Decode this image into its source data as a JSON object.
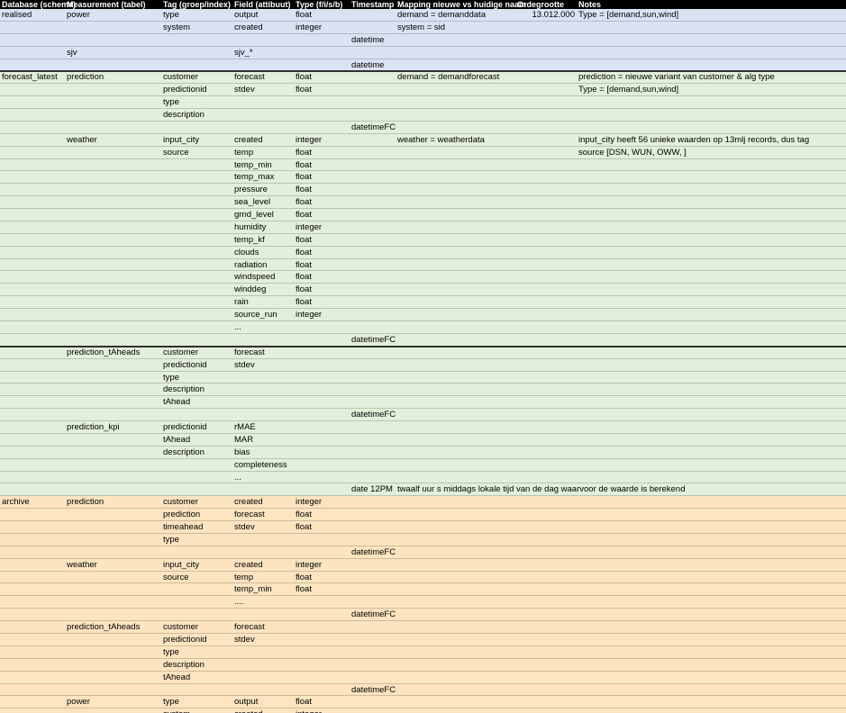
{
  "header": {
    "db": "Database (schema)",
    "measurement": "Measurement (tabel)",
    "tag": "Tag (groep/index)",
    "field": "Field (attibuut)",
    "type": "Type (f/i/s/b)",
    "timestamp": "Timestamp",
    "mapping": "Mapping nieuwe vs huidige naam",
    "ordegrootte": "Ordegrootte",
    "notes": "Notes"
  },
  "rows": [
    {
      "section": "blue",
      "db": "realised",
      "measurement": "power",
      "tag": "type",
      "field": "output",
      "type": "float",
      "timestamp": "",
      "mapping": "demand = demanddata",
      "ordegrootte": "13.012.000",
      "notes": "Type = [demand,sun,wind]"
    },
    {
      "section": "blue",
      "db": "",
      "measurement": "",
      "tag": "system",
      "field": "created",
      "type": "integer",
      "timestamp": "",
      "mapping": "system = sid",
      "ordegrootte": "",
      "notes": ""
    },
    {
      "section": "blue",
      "db": "",
      "measurement": "",
      "tag": "",
      "field": "",
      "type": "",
      "timestamp": "datetime",
      "mapping": "",
      "ordegrootte": "",
      "notes": ""
    },
    {
      "section": "blue",
      "db": "",
      "measurement": "sjv",
      "tag": "",
      "field": "sjv_*",
      "type": "",
      "timestamp": "",
      "mapping": "",
      "ordegrootte": "",
      "notes": ""
    },
    {
      "section": "blue",
      "db": "",
      "measurement": "",
      "tag": "",
      "field": "",
      "type": "",
      "timestamp": "datetime",
      "mapping": "",
      "ordegrootte": "",
      "notes": ""
    },
    {
      "section": "green",
      "db": "forecast_latest",
      "measurement": "prediction",
      "tag": "customer",
      "field": "forecast",
      "type": "float",
      "timestamp": "",
      "mapping": "demand = demandforecast",
      "ordegrootte": "",
      "notes": "prediction = nieuwe variant van customer & alg type"
    },
    {
      "section": "green",
      "db": "",
      "measurement": "",
      "tag": "predictionid",
      "field": "stdev",
      "type": "float",
      "timestamp": "",
      "mapping": "",
      "ordegrootte": "",
      "notes": "Type = [demand,sun,wind]"
    },
    {
      "section": "green",
      "db": "",
      "measurement": "",
      "tag": "type",
      "field": "",
      "type": "",
      "timestamp": "",
      "mapping": "",
      "ordegrootte": "",
      "notes": ""
    },
    {
      "section": "green",
      "db": "",
      "measurement": "",
      "tag": "description",
      "field": "",
      "type": "",
      "timestamp": "",
      "mapping": "",
      "ordegrootte": "",
      "notes": ""
    },
    {
      "section": "green",
      "db": "",
      "measurement": "",
      "tag": "",
      "field": "",
      "type": "",
      "timestamp": "datetimeFC",
      "mapping": "",
      "ordegrootte": "",
      "notes": ""
    },
    {
      "section": "green",
      "db": "",
      "measurement": "weather",
      "tag": "input_city",
      "field": "created",
      "type": "integer",
      "timestamp": "",
      "mapping": "weather = weatherdata",
      "ordegrootte": "",
      "notes": "input_city heeft 56 unieke waarden op 13mlj records, dus tag"
    },
    {
      "section": "green",
      "db": "",
      "measurement": "",
      "tag": "source",
      "field": "temp",
      "type": "float",
      "timestamp": "",
      "mapping": "",
      "ordegrootte": "",
      "notes": "source [DSN, WUN, OWW, ]"
    },
    {
      "section": "green",
      "db": "",
      "measurement": "",
      "tag": "",
      "field": "temp_min",
      "type": "float",
      "timestamp": "",
      "mapping": "",
      "ordegrootte": "",
      "notes": ""
    },
    {
      "section": "green",
      "db": "",
      "measurement": "",
      "tag": "",
      "field": "temp_max",
      "type": "float",
      "timestamp": "",
      "mapping": "",
      "ordegrootte": "",
      "notes": ""
    },
    {
      "section": "green",
      "db": "",
      "measurement": "",
      "tag": "",
      "field": "pressure",
      "type": "float",
      "timestamp": "",
      "mapping": "",
      "ordegrootte": "",
      "notes": ""
    },
    {
      "section": "green",
      "db": "",
      "measurement": "",
      "tag": "",
      "field": "sea_level",
      "type": "float",
      "timestamp": "",
      "mapping": "",
      "ordegrootte": "",
      "notes": ""
    },
    {
      "section": "green",
      "db": "",
      "measurement": "",
      "tag": "",
      "field": "grnd_level",
      "type": "float",
      "timestamp": "",
      "mapping": "",
      "ordegrootte": "",
      "notes": ""
    },
    {
      "section": "green",
      "db": "",
      "measurement": "",
      "tag": "",
      "field": "humidity",
      "type": "integer",
      "timestamp": "",
      "mapping": "",
      "ordegrootte": "",
      "notes": ""
    },
    {
      "section": "green",
      "db": "",
      "measurement": "",
      "tag": "",
      "field": "temp_kf",
      "type": "float",
      "timestamp": "",
      "mapping": "",
      "ordegrootte": "",
      "notes": ""
    },
    {
      "section": "green",
      "db": "",
      "measurement": "",
      "tag": "",
      "field": "clouds",
      "type": "float",
      "timestamp": "",
      "mapping": "",
      "ordegrootte": "",
      "notes": ""
    },
    {
      "section": "green",
      "db": "",
      "measurement": "",
      "tag": "",
      "field": "radiation",
      "type": "float",
      "timestamp": "",
      "mapping": "",
      "ordegrootte": "",
      "notes": ""
    },
    {
      "section": "green",
      "db": "",
      "measurement": "",
      "tag": "",
      "field": "windspeed",
      "type": "float",
      "timestamp": "",
      "mapping": "",
      "ordegrootte": "",
      "notes": ""
    },
    {
      "section": "green",
      "db": "",
      "measurement": "",
      "tag": "",
      "field": "winddeg",
      "type": "float",
      "timestamp": "",
      "mapping": "",
      "ordegrootte": "",
      "notes": ""
    },
    {
      "section": "green",
      "db": "",
      "measurement": "",
      "tag": "",
      "field": "rain",
      "type": "float",
      "timestamp": "",
      "mapping": "",
      "ordegrootte": "",
      "notes": ""
    },
    {
      "section": "green",
      "db": "",
      "measurement": "",
      "tag": "",
      "field": "source_run",
      "type": "integer",
      "timestamp": "",
      "mapping": "",
      "ordegrootte": "",
      "notes": ""
    },
    {
      "section": "green",
      "db": "",
      "measurement": "",
      "tag": "",
      "field": "...",
      "type": "",
      "timestamp": "",
      "mapping": "",
      "ordegrootte": "",
      "notes": ""
    },
    {
      "section": "green",
      "db": "",
      "measurement": "",
      "tag": "",
      "field": "",
      "type": "",
      "timestamp": "datetimeFC",
      "mapping": "",
      "ordegrootte": "",
      "notes": ""
    },
    {
      "section": "green",
      "db": "",
      "measurement": "prediction_tAheads",
      "tag": "customer",
      "field": "forecast",
      "type": "",
      "timestamp": "",
      "mapping": "",
      "ordegrootte": "",
      "notes": ""
    },
    {
      "section": "green",
      "db": "",
      "measurement": "",
      "tag": "predictionid",
      "field": "stdev",
      "type": "",
      "timestamp": "",
      "mapping": "",
      "ordegrootte": "",
      "notes": ""
    },
    {
      "section": "green",
      "db": "",
      "measurement": "",
      "tag": "type",
      "field": "",
      "type": "",
      "timestamp": "",
      "mapping": "",
      "ordegrootte": "",
      "notes": ""
    },
    {
      "section": "green",
      "db": "",
      "measurement": "",
      "tag": "description",
      "field": "",
      "type": "",
      "timestamp": "",
      "mapping": "",
      "ordegrootte": "",
      "notes": ""
    },
    {
      "section": "green",
      "db": "",
      "measurement": "",
      "tag": "tAhead",
      "field": "",
      "type": "",
      "timestamp": "",
      "mapping": "",
      "ordegrootte": "",
      "notes": ""
    },
    {
      "section": "green",
      "db": "",
      "measurement": "",
      "tag": "",
      "field": "",
      "type": "",
      "timestamp": "datetimeFC",
      "mapping": "",
      "ordegrootte": "",
      "notes": ""
    },
    {
      "section": "green",
      "db": "",
      "measurement": "prediction_kpi",
      "tag": "predictionid",
      "field": "rMAE",
      "type": "",
      "timestamp": "",
      "mapping": "",
      "ordegrootte": "",
      "notes": ""
    },
    {
      "section": "green",
      "db": "",
      "measurement": "",
      "tag": "tAhead",
      "field": "MAR",
      "type": "",
      "timestamp": "",
      "mapping": "",
      "ordegrootte": "",
      "notes": ""
    },
    {
      "section": "green",
      "db": "",
      "measurement": "",
      "tag": "description",
      "field": "bias",
      "type": "",
      "timestamp": "",
      "mapping": "",
      "ordegrootte": "",
      "notes": ""
    },
    {
      "section": "green",
      "db": "",
      "measurement": "",
      "tag": "",
      "field": "completeness",
      "type": "",
      "timestamp": "",
      "mapping": "",
      "ordegrootte": "",
      "notes": ""
    },
    {
      "section": "green",
      "db": "",
      "measurement": "",
      "tag": "",
      "field": "...",
      "type": "",
      "timestamp": "",
      "mapping": "",
      "ordegrootte": "",
      "notes": ""
    },
    {
      "section": "green",
      "db": "",
      "measurement": "",
      "tag": "",
      "field": "",
      "type": "",
      "timestamp": "date 12PM",
      "mapping": "twaalf uur s middags lokale tijd van de dag waarvoor de waarde is berekend",
      "ordegrootte": "",
      "notes": ""
    },
    {
      "section": "orange",
      "db": "archive",
      "measurement": "prediction",
      "tag": "customer",
      "field": "created",
      "type": "integer",
      "timestamp": "",
      "mapping": "",
      "ordegrootte": "",
      "notes": ""
    },
    {
      "section": "orange",
      "db": "",
      "measurement": "",
      "tag": "prediction",
      "field": "forecast",
      "type": "float",
      "timestamp": "",
      "mapping": "",
      "ordegrootte": "",
      "notes": ""
    },
    {
      "section": "orange",
      "db": "",
      "measurement": "",
      "tag": "timeahead",
      "field": "stdev",
      "type": "float",
      "timestamp": "",
      "mapping": "",
      "ordegrootte": "",
      "notes": ""
    },
    {
      "section": "orange",
      "db": "",
      "measurement": "",
      "tag": "type",
      "field": "",
      "type": "",
      "timestamp": "",
      "mapping": "",
      "ordegrootte": "",
      "notes": ""
    },
    {
      "section": "orange",
      "db": "",
      "measurement": "",
      "tag": "",
      "field": "",
      "type": "",
      "timestamp": "datetimeFC",
      "mapping": "",
      "ordegrootte": "",
      "notes": ""
    },
    {
      "section": "orange",
      "db": "",
      "measurement": "weather",
      "tag": "input_city",
      "field": "created",
      "type": "integer",
      "timestamp": "",
      "mapping": "",
      "ordegrootte": "",
      "notes": ""
    },
    {
      "section": "orange",
      "db": "",
      "measurement": "",
      "tag": "source",
      "field": "temp",
      "type": "float",
      "timestamp": "",
      "mapping": "",
      "ordegrootte": "",
      "notes": ""
    },
    {
      "section": "orange",
      "db": "",
      "measurement": "",
      "tag": "",
      "field": "temp_min",
      "type": "float",
      "timestamp": "",
      "mapping": "",
      "ordegrootte": "",
      "notes": ""
    },
    {
      "section": "orange",
      "db": "",
      "measurement": "",
      "tag": "",
      "field": "....",
      "type": "",
      "timestamp": "",
      "mapping": "",
      "ordegrootte": "",
      "notes": ""
    },
    {
      "section": "orange",
      "db": "",
      "measurement": "",
      "tag": "",
      "field": "",
      "type": "",
      "timestamp": "datetimeFC",
      "mapping": "",
      "ordegrootte": "",
      "notes": ""
    },
    {
      "section": "orange",
      "db": "",
      "measurement": "prediction_tAheads",
      "tag": "customer",
      "field": "forecast",
      "type": "",
      "timestamp": "",
      "mapping": "",
      "ordegrootte": "",
      "notes": ""
    },
    {
      "section": "orange",
      "db": "",
      "measurement": "",
      "tag": "predictionid",
      "field": "stdev",
      "type": "",
      "timestamp": "",
      "mapping": "",
      "ordegrootte": "",
      "notes": ""
    },
    {
      "section": "orange",
      "db": "",
      "measurement": "",
      "tag": "type",
      "field": "",
      "type": "",
      "timestamp": "",
      "mapping": "",
      "ordegrootte": "",
      "notes": ""
    },
    {
      "section": "orange",
      "db": "",
      "measurement": "",
      "tag": "description",
      "field": "",
      "type": "",
      "timestamp": "",
      "mapping": "",
      "ordegrootte": "",
      "notes": ""
    },
    {
      "section": "orange",
      "db": "",
      "measurement": "",
      "tag": "tAhead",
      "field": "",
      "type": "",
      "timestamp": "",
      "mapping": "",
      "ordegrootte": "",
      "notes": ""
    },
    {
      "section": "orange",
      "db": "",
      "measurement": "",
      "tag": "",
      "field": "",
      "type": "",
      "timestamp": "datetimeFC",
      "mapping": "",
      "ordegrootte": "",
      "notes": ""
    },
    {
      "section": "orange",
      "db": "",
      "measurement": "power",
      "tag": "type",
      "field": "output",
      "type": "float",
      "timestamp": "",
      "mapping": "",
      "ordegrootte": "",
      "notes": ""
    },
    {
      "section": "orange",
      "db": "",
      "measurement": "",
      "tag": "system",
      "field": "created",
      "type": "integer",
      "timestamp": "",
      "mapping": "",
      "ordegrootte": "",
      "notes": ""
    }
  ],
  "colors": {
    "header_bg": "#000000",
    "header_fg": "#ffffff",
    "blue": "#dae3f3",
    "green": "#e2efda",
    "orange": "#fce4c0"
  }
}
